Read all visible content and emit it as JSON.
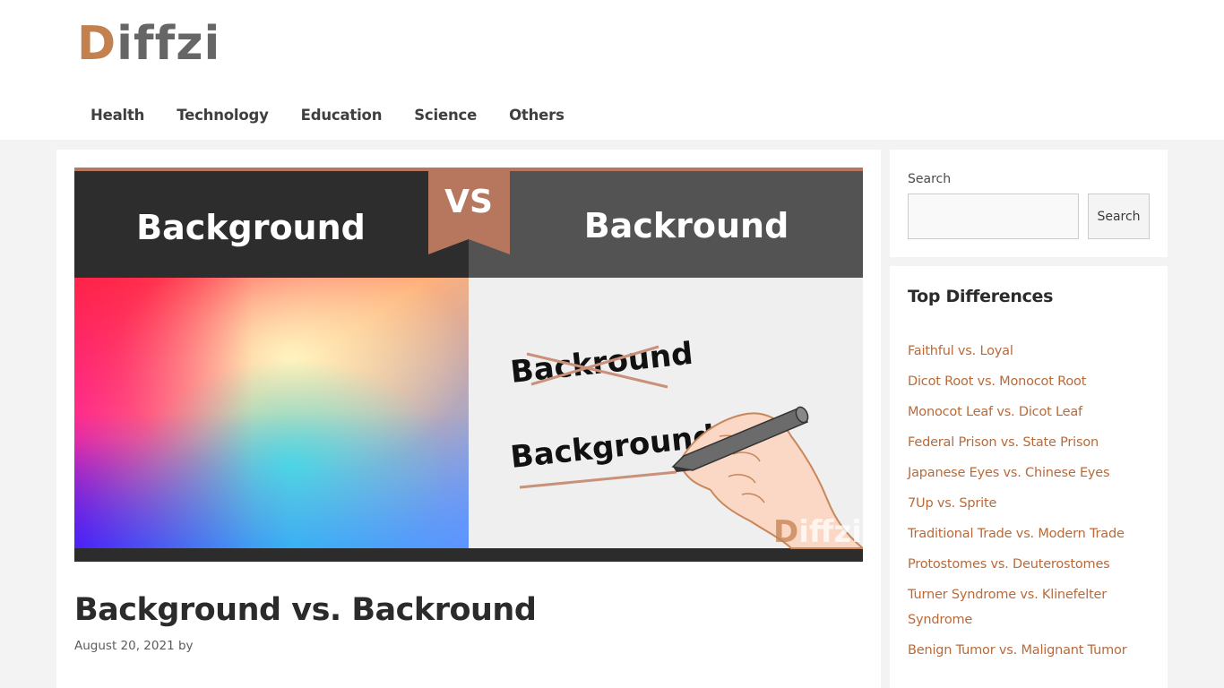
{
  "site": {
    "logo_first": "D",
    "logo_rest": "iffzi",
    "brand_color": "#c3814f",
    "link_color": "#b86a3a"
  },
  "nav": {
    "items": [
      {
        "label": "Health"
      },
      {
        "label": "Technology"
      },
      {
        "label": "Education"
      },
      {
        "label": "Science"
      },
      {
        "label": "Others"
      }
    ]
  },
  "featured_image": {
    "left_heading": "Background",
    "right_heading": "Backround",
    "vs_label": "VS",
    "wrong_word": "Backround",
    "right_word": "Background",
    "watermark_first": "D",
    "watermark_rest": "iffzi"
  },
  "article": {
    "title": "Background vs. Backround",
    "meta": "August 20, 2021 by"
  },
  "sidebar": {
    "search": {
      "label": "Search",
      "input_value": "",
      "input_placeholder": "",
      "button_label": "Search"
    },
    "top_differences": {
      "title": "Top Differences",
      "items": [
        {
          "label": "Faithful vs. Loyal"
        },
        {
          "label": "Dicot Root vs. Monocot Root"
        },
        {
          "label": "Monocot Leaf vs. Dicot Leaf"
        },
        {
          "label": "Federal Prison vs. State Prison"
        },
        {
          "label": "Japanese Eyes vs. Chinese Eyes"
        },
        {
          "label": "7Up vs. Sprite"
        },
        {
          "label": "Traditional Trade vs. Modern Trade"
        },
        {
          "label": "Protostomes vs. Deuterostomes"
        },
        {
          "label": "Turner Syndrome vs. Klinefelter Syndrome"
        },
        {
          "label": "Benign Tumor vs. Malignant Tumor"
        }
      ]
    }
  }
}
